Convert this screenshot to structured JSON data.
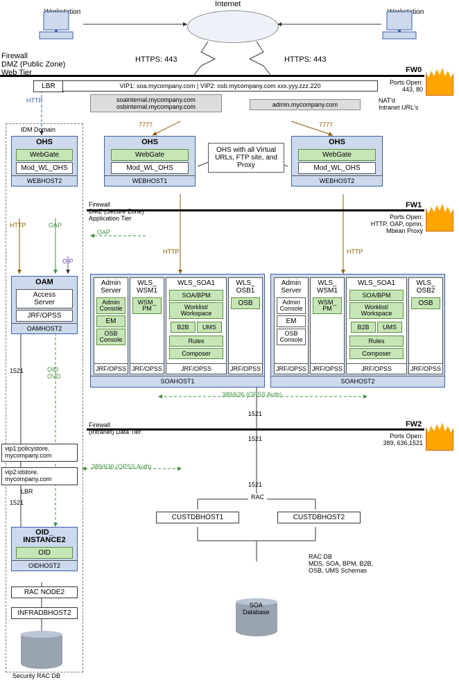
{
  "top": {
    "internet": "Internet",
    "workstation": "Workstation",
    "https": "HTTPS: 443"
  },
  "fw0": {
    "side_label": "Firewall\nDMZ (Public Zone)\nWeb Tier",
    "name": "FW0",
    "ports": "Ports Open:\n443, 80",
    "lbr": "LBR",
    "vip_row": "VIP1: soa.mycompany.com | VIP2: osb.mycompany.com  xxx.yyy.zzz.220",
    "intranet_left": "soainternal.mycompany.com\nosbinternal.mycompany.com",
    "intranet_right": "admin.mycompany.com",
    "nat": "NAT'd\nIntranet URL's",
    "http_left": "HTTP",
    "port7777": "7777"
  },
  "idm": {
    "title": "IDM Domain",
    "ohs": {
      "name": "OHS",
      "webgate": "WebGate",
      "mod": "Mod_WL_OHS",
      "host": "WEBHOST2"
    },
    "labels": {
      "http": "HTTP",
      "oap": "OAP",
      "oap_arrow": "OAP",
      "oip": "OIP"
    },
    "oam": {
      "name": "OAM",
      "access": "Access\nServer",
      "jrf": "JRF/OPSS",
      "host": "OAMHOST2"
    },
    "port1521": "1521",
    "oid_ovd": "OID\nOVD",
    "vip1": "vip1:policystore.\nmycompany.com",
    "vip2": "vip2:idstore.\nmycompany.com",
    "lbr": "LBR",
    "oid": {
      "name": "OID_\nINSTANCE2",
      "oid": "OID",
      "host": "OIDHOST2"
    },
    "rac_node": "RAC NODE2",
    "infradb": "INFRADBHOST2",
    "sec_db": "Security RAC DB",
    "opss": "389/636 (OPSS Auth)"
  },
  "webtier": {
    "ohs": "OHS",
    "webgate": "WebGate",
    "mod": "Mod_WL_OHS",
    "host1": "WEBHOST1",
    "host2": "WEBHOST2",
    "note": "OHS with all Virtual URLs, FTP site, and Proxy"
  },
  "fw1": {
    "side_label": "Firewall\nDMZ (Secure Zone)\nApplication Tier",
    "name": "FW1",
    "ports": "Ports Open:\nHTTP, OAP, opmn,\nMbean Proxy",
    "http": "HTTP"
  },
  "app": {
    "cols": {
      "admin": "Admin\nServer",
      "wsm": "WLS_\nWSM1",
      "soa": "WLS_SOA1",
      "osb1": "WLS_\nOSB1",
      "osb2": "WLS_\nOSB2"
    },
    "slots": {
      "admin_console": "Admin\nConsole",
      "em": "EM",
      "osb_console": "OSB\nConsole",
      "wsm_pm": "WSM_\nPM",
      "soa_bpm": "SOA/BPM",
      "worklist": "Worklist/\nWorkspace",
      "b2b": "B2B",
      "ums": "UMS",
      "rules": "Rules",
      "composer": "Composer",
      "osb": "OSB"
    },
    "jrf": "JRF/OPSS",
    "host1": "SOAHOST1",
    "host2": "SOAHOST2",
    "opss": "389/636 (OPSS Auth)",
    "port1521": "1521"
  },
  "fw2": {
    "side_label": "Firewall\n(Intranet) Data Tier",
    "name": "FW2",
    "ports": "Ports Open:\n389, 636,1521"
  },
  "db": {
    "port1521": "1521",
    "rac": "RAC",
    "host1": "CUSTDBHOST1",
    "host2": "CUSTDBHOST2",
    "racdb": "RAC DB\nMDS, SOA, BPM, B2B,\nOSB, UMS Schemas",
    "soadb": "SOA\nDatabase"
  }
}
